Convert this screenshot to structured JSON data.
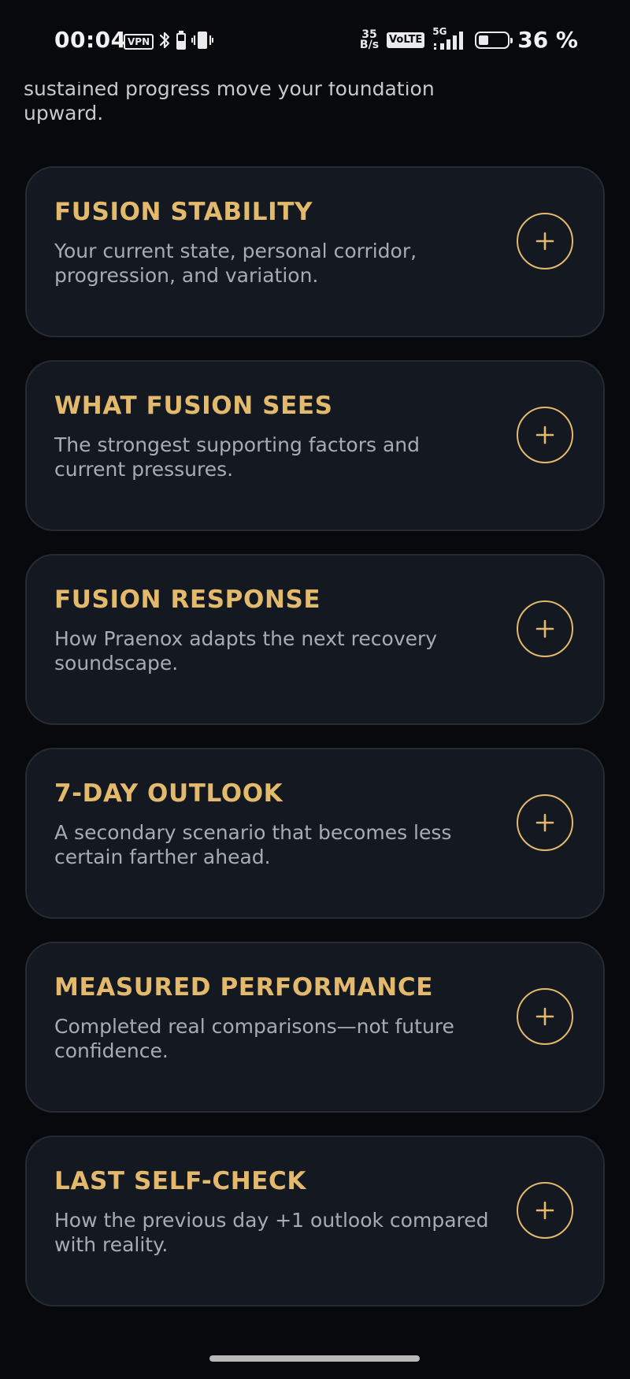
{
  "status_bar": {
    "time": "00:04",
    "vpn_label": "VPN",
    "net_speed_value": "35",
    "net_speed_unit": "B/s",
    "volte_label": "VoLTE",
    "network_label": "5G",
    "battery_percent": "36 %",
    "battery_level": 0.36,
    "icons": [
      "vpn-icon",
      "bluetooth-icon",
      "battery-saver-icon",
      "vibrate-icon",
      "signal-icon",
      "battery-icon"
    ]
  },
  "intro": {
    "text": "pattern, reduces disruptive drift, and lets sustained progress move your foundation upward."
  },
  "sections": [
    {
      "title": "FUSION STABILITY",
      "description": "Your current state, personal corridor, progression, and variation.",
      "action_icon": "plus-icon"
    },
    {
      "title": "WHAT FUSION SEES",
      "description": "The strongest supporting factors and current pressures.",
      "action_icon": "plus-icon"
    },
    {
      "title": "FUSION RESPONSE",
      "description": "How Praenox adapts the next recovery soundscape.",
      "action_icon": "plus-icon"
    },
    {
      "title": "7-DAY OUTLOOK",
      "description": "A secondary scenario that becomes less certain farther ahead.",
      "action_icon": "plus-icon"
    },
    {
      "title": "MEASURED PERFORMANCE",
      "description": "Completed real comparisons—not future confidence.",
      "action_icon": "plus-icon"
    },
    {
      "title": "LAST SELF-CHECK",
      "description": "How the previous day +1 outlook compared with reality.",
      "action_icon": "plus-icon"
    }
  ],
  "colors": {
    "background": "#07090c",
    "card": "#141821",
    "accent_gold": "#e3b96c",
    "text_muted": "#a7acb3"
  }
}
